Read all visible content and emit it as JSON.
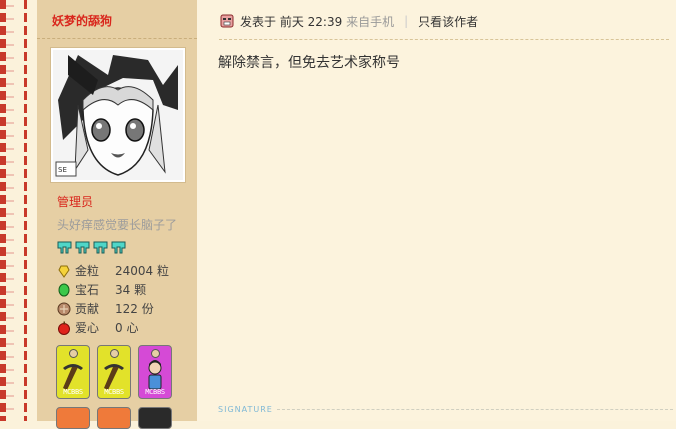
{
  "author": {
    "name": "妖梦的舔狗",
    "usergroup": "管理员",
    "custom_title": "头好痒感觉要长脑子了",
    "level_icon_count": 4
  },
  "stats": [
    {
      "icon": "gold-nugget-icon",
      "label": "金粒",
      "value": "24004 粒"
    },
    {
      "icon": "emerald-icon",
      "label": "宝石",
      "value": "34 颗"
    },
    {
      "icon": "contribution-icon",
      "label": "贡献",
      "value": "122 份"
    },
    {
      "icon": "apple-heart-icon",
      "label": "爱心",
      "value": "0 心"
    }
  ],
  "medals": [
    {
      "icon": "pickaxe-icon",
      "color": "#e2e22a",
      "tag": "MCBBS"
    },
    {
      "icon": "pickaxe-icon",
      "color": "#e2e22a",
      "tag": "MCBBS"
    },
    {
      "icon": "character-icon",
      "color": "#d54ad6",
      "tag": "MCBBS"
    }
  ],
  "post": {
    "posted_label": "发表于",
    "time": "前天 22:39",
    "source": "来自手机",
    "only_author": "只看该作者",
    "content": "解除禁言，但免去艺术家称号",
    "signature_label": "SIGNATURE"
  },
  "colors": {
    "accent_red": "#d9271d",
    "sidebar_bg": "#e6cfa4",
    "page_bg": "#fcf3dd"
  }
}
